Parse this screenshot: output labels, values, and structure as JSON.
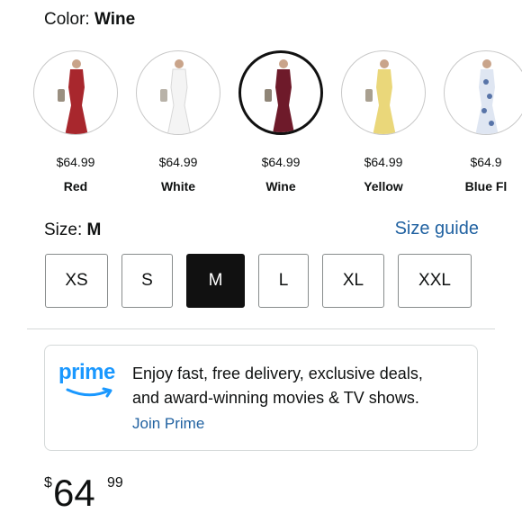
{
  "color": {
    "label": "Color:",
    "value": "Wine"
  },
  "swatches": [
    {
      "name": "Red",
      "price": "$64.99",
      "dress_color": "#a8272d",
      "selected": false
    },
    {
      "name": "White",
      "price": "$64.99",
      "dress_color": "#f4f4f4",
      "selected": false
    },
    {
      "name": "Wine",
      "price": "$64.99",
      "dress_color": "#6e1a2a",
      "selected": true
    },
    {
      "name": "Yellow",
      "price": "$64.99",
      "dress_color": "#ead77a",
      "selected": false
    },
    {
      "name": "Blue Fl",
      "price": "$64.9",
      "dress_color": "#c9d6ea",
      "selected": false
    }
  ],
  "size": {
    "label": "Size:",
    "value": "M",
    "guide": "Size guide"
  },
  "sizes": [
    "XS",
    "S",
    "M",
    "L",
    "XL",
    "XXL"
  ],
  "prime": {
    "logo": "prime",
    "line1": "Enjoy fast, free delivery, exclusive deals,",
    "line2": "and award-winning movies & TV shows.",
    "join": "Join Prime"
  },
  "price": {
    "symbol": "$",
    "whole": "64",
    "fraction": "99"
  },
  "colors": {
    "link": "#2162a1",
    "prime_blue": "#1a98ff",
    "selected": "#111111"
  }
}
